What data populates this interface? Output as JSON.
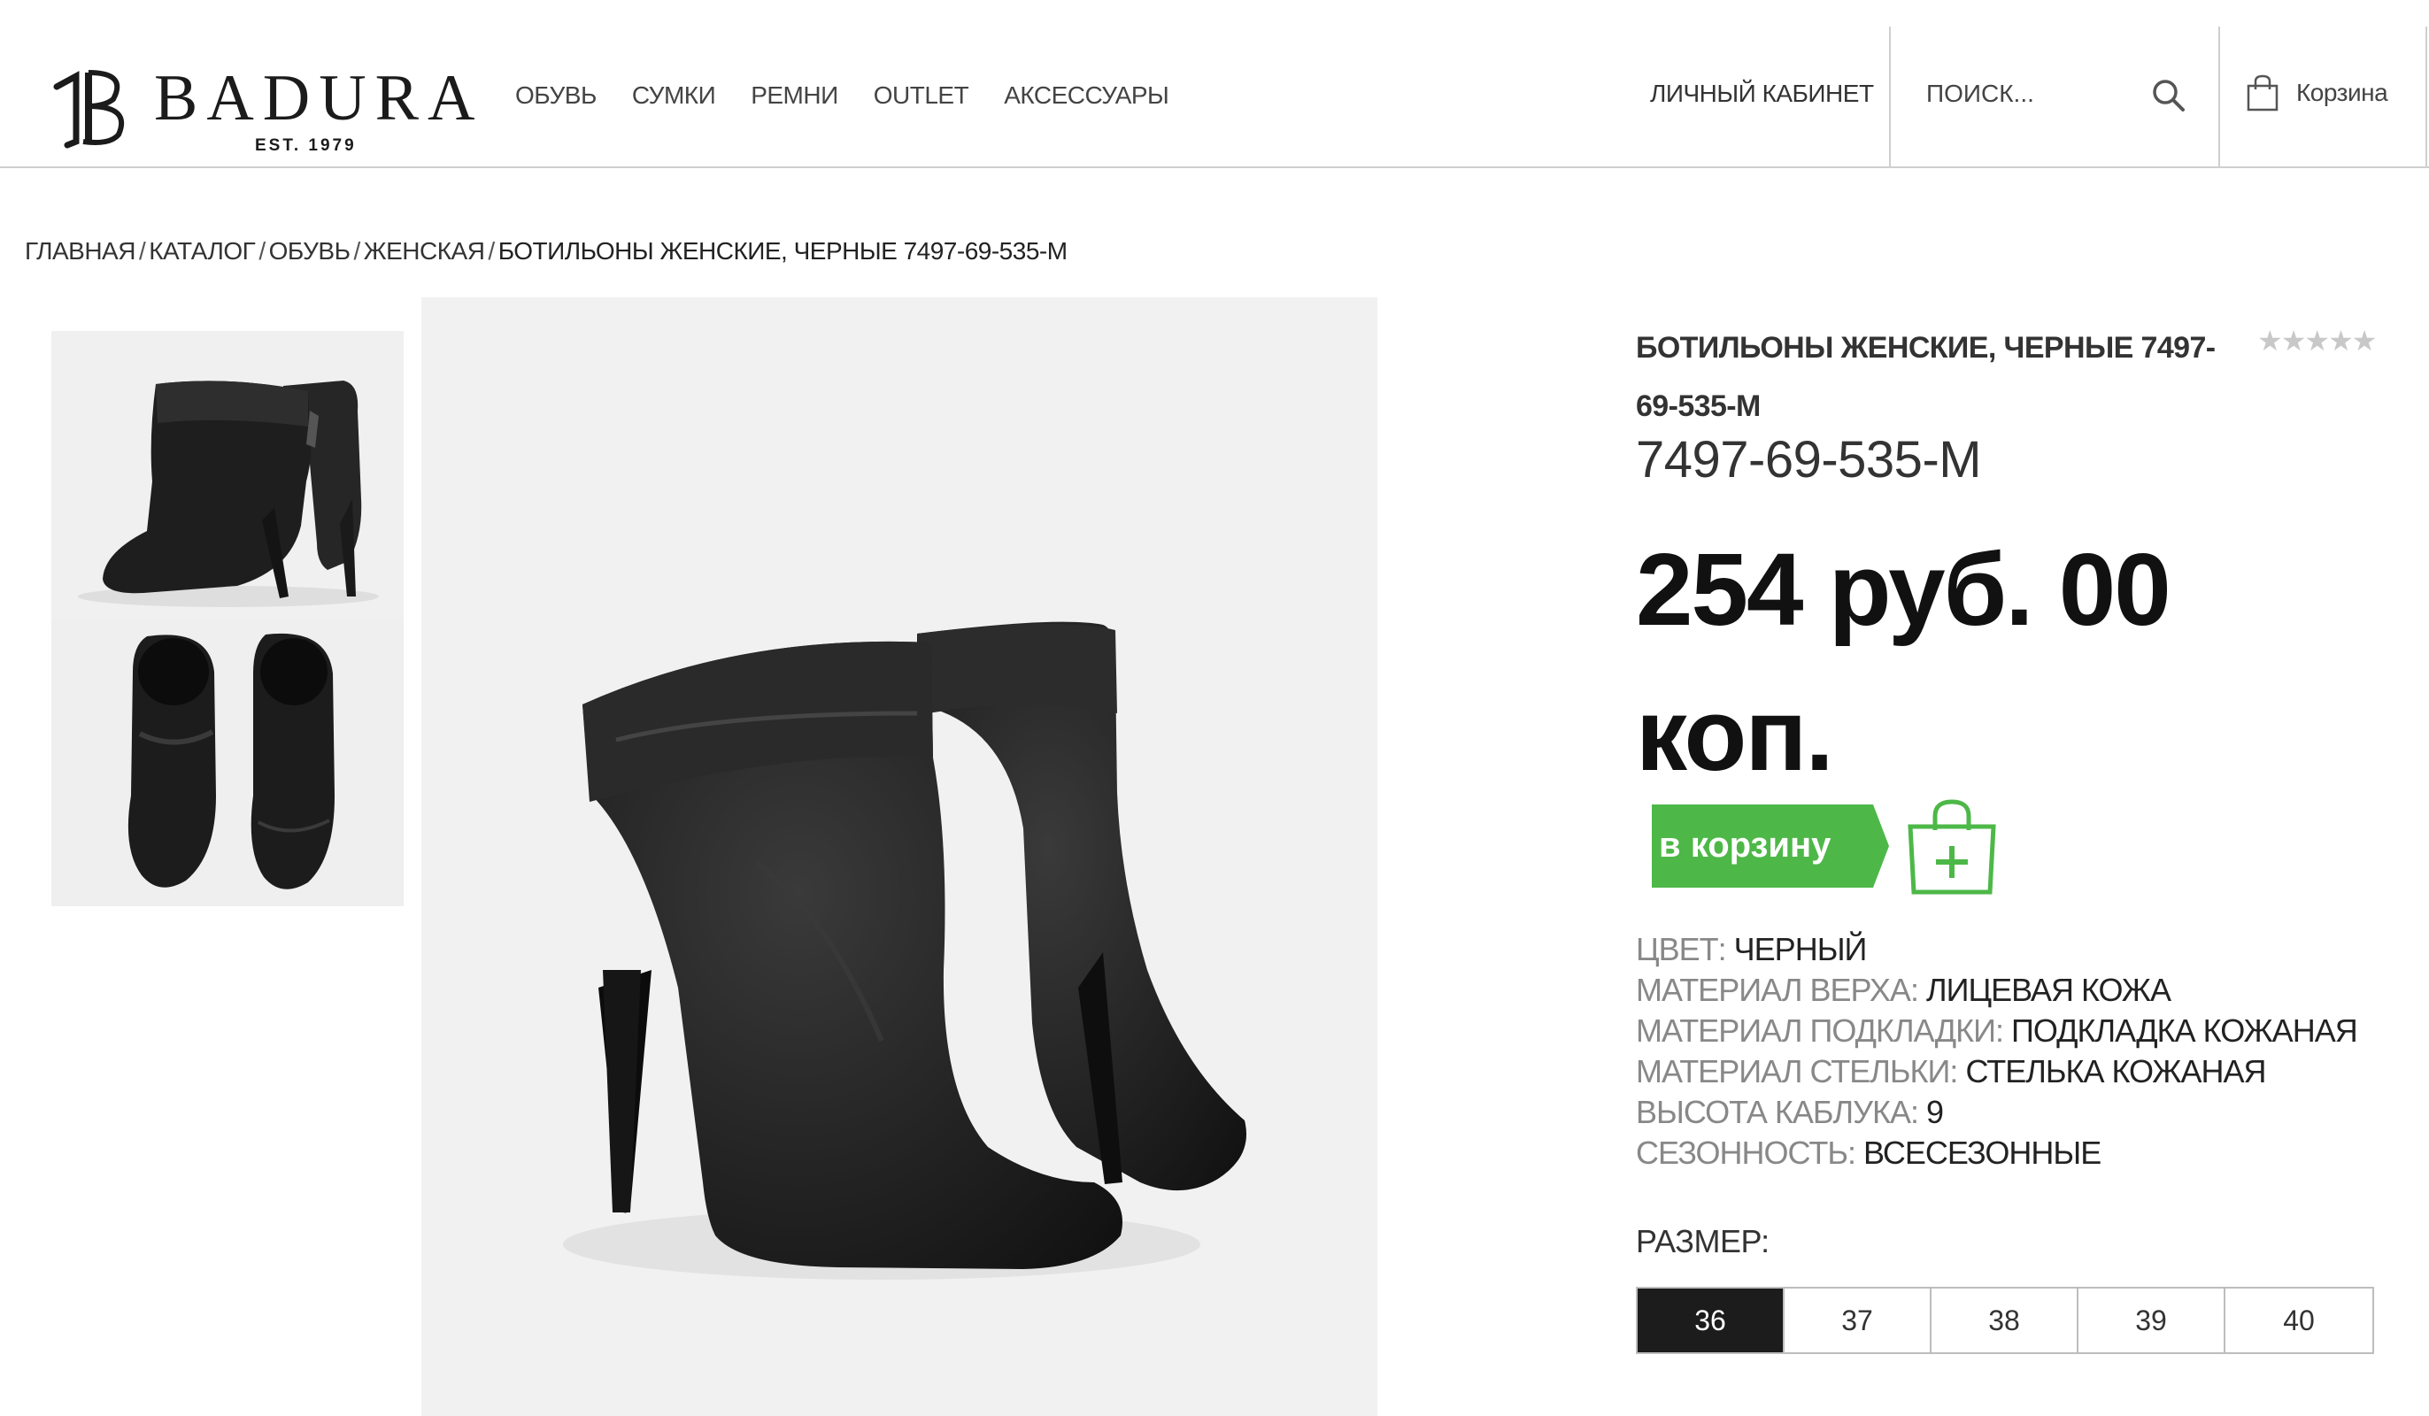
{
  "header": {
    "logo_word": "BADURA",
    "logo_est": "EST. 1979",
    "nav": [
      "ОБУВЬ",
      "СУМКИ",
      "РЕМНИ",
      "OUTLET",
      "АКСЕССУАРЫ"
    ],
    "account_label": "ЛИЧНЫЙ КАБИНЕТ",
    "search_placeholder": "ПОИСК...",
    "cart_label": "Корзина"
  },
  "breadcrumb": {
    "items": [
      "ГЛАВНАЯ",
      "КАТАЛОГ",
      "ОБУВЬ",
      "ЖЕНСКАЯ"
    ],
    "current": "БОТИЛЬОНЫ ЖЕНСКИЕ, ЧЕРНЫЕ 7497-69-535-М"
  },
  "product": {
    "title": "БОТИЛЬОНЫ ЖЕНСКИЕ, ЧЕРНЫЕ 7497-69-535-М",
    "rating_stars": "★★★★★",
    "sku": "7497-69-535-М",
    "price": "254 руб. 00 коп.",
    "buy_label": "в корзину",
    "specs": [
      {
        "label": "ЦВЕТ:",
        "value": "ЧЕРНЫЙ"
      },
      {
        "label": "МАТЕРИАЛ ВЕРХА:",
        "value": "ЛИЦЕВАЯ КОЖА"
      },
      {
        "label": "МАТЕРИАЛ ПОДКЛАДКИ:",
        "value": "ПОДКЛАДКА КОЖАНАЯ"
      },
      {
        "label": "МАТЕРИАЛ СТЕЛЬКИ:",
        "value": "СТЕЛЬКА КОЖАНАЯ"
      },
      {
        "label": "ВЫСОТА КАБЛУКА:",
        "value": "9"
      },
      {
        "label": "СЕЗОННОСТЬ:",
        "value": "ВСЕСЕЗОННЫЕ"
      }
    ],
    "size_label": "РАЗМЕР:",
    "sizes": [
      "36",
      "37",
      "38",
      "39",
      "40"
    ],
    "selected_size": "36"
  },
  "colors": {
    "buy_green": "#4db848",
    "selected_size_bg": "#1c1c1c",
    "rating_grey": "#c8c8c8"
  },
  "icons": {
    "search": "search-icon",
    "cart": "shopping-bag-icon",
    "add_to_cart": "bag-plus-icon"
  }
}
